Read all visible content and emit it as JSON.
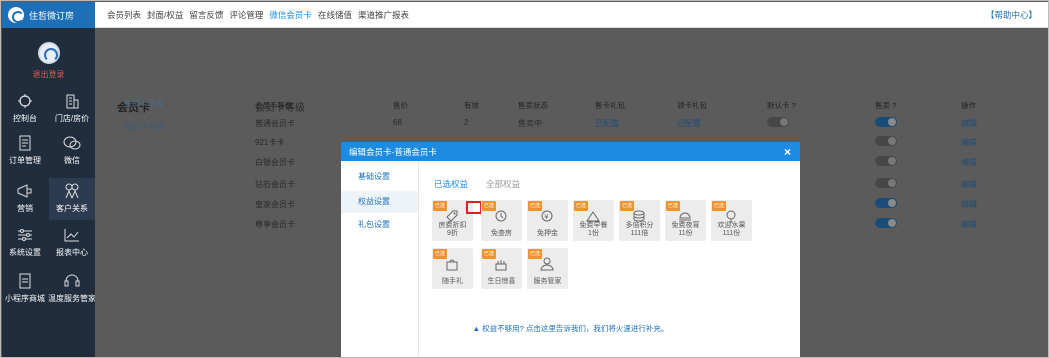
{
  "brand": {
    "name": "住哲微订房"
  },
  "sidebar": {
    "logout": "退出登录",
    "items": [
      {
        "label": "控制台",
        "icon": "dashboard-icon"
      },
      {
        "label": "门店/房价",
        "icon": "store-icon"
      },
      {
        "label": "订单管理",
        "icon": "order-icon"
      },
      {
        "label": "微信",
        "icon": "wechat-icon"
      },
      {
        "label": "营销",
        "icon": "marketing-icon"
      },
      {
        "label": "客户关系",
        "icon": "customer-icon"
      },
      {
        "label": "系统设置",
        "icon": "settings-icon"
      },
      {
        "label": "报表中心",
        "icon": "report-icon"
      },
      {
        "label": "小程序商城",
        "icon": "mall-icon"
      },
      {
        "label": "温度服务管家",
        "icon": "service-icon"
      }
    ]
  },
  "topnav": {
    "items": [
      "会员列表",
      "封面/权益",
      "留言反馈",
      "评论管理",
      "微信会员卡",
      "在线储值",
      "渠道推广报表"
    ],
    "active_index": 4,
    "help": "【帮助中心】"
  },
  "page": {
    "title": "会员卡",
    "left_tabs": [
      "会员卡设置",
      "会员卡升级"
    ],
    "level_title": "会员卡等级",
    "table": {
      "headers": [
        "会员卡等级",
        "售价",
        "有效",
        "售卖状态",
        "售卡礼包",
        "领卡礼包",
        "默认卡 ?",
        "售卖 ?",
        "操作"
      ],
      "rows": [
        {
          "name": "普通会员卡",
          "price": "68",
          "valid": "2",
          "status": "售卖中",
          "gift1": "已配置",
          "gift2": "已配置",
          "edit": "编辑"
        },
        {
          "name": "921卡卡",
          "price": "",
          "valid": "",
          "status": "",
          "gift1": "",
          "gift2": "",
          "edit": "编辑"
        },
        {
          "name": "白银会员卡",
          "price": "",
          "valid": "",
          "status": "",
          "gift1": "",
          "gift2": "",
          "edit": "编辑"
        },
        {
          "name": "钻石会员卡",
          "price": "",
          "valid": "",
          "status": "",
          "gift1": "",
          "gift2": "",
          "edit": "编辑"
        },
        {
          "name": "皇家会员卡",
          "price": "",
          "valid": "",
          "status": "",
          "gift1": "",
          "gift2": "",
          "edit": "编辑"
        },
        {
          "name": "尊享会员卡",
          "price": "",
          "valid": "",
          "status": "",
          "gift1": "",
          "gift2": "",
          "edit": "编辑"
        }
      ]
    }
  },
  "modal": {
    "title": "编辑会员卡-普通会员卡",
    "close": "×",
    "menu": [
      "基础设置",
      "权益设置",
      "礼包设置"
    ],
    "menu_selected": 1,
    "tabs": [
      "已选权益",
      "全部权益"
    ],
    "tag": "已选",
    "benefits": [
      {
        "label": "房费折扣",
        "sub": "9折",
        "icon": "discount-tag-icon"
      },
      {
        "label": "免查房",
        "sub": "",
        "icon": "no-inspection-icon"
      },
      {
        "label": "免押金",
        "sub": "",
        "icon": "no-deposit-icon"
      },
      {
        "label": "免费早餐",
        "sub": "1份",
        "icon": "breakfast-icon"
      },
      {
        "label": "多倍积分",
        "sub": "111倍",
        "icon": "points-icon"
      },
      {
        "label": "免费夜宵",
        "sub": "11份",
        "icon": "night-snack-icon"
      },
      {
        "label": "欢迎水果",
        "sub": "111份",
        "icon": "fruit-icon"
      },
      {
        "label": "随手礼",
        "sub": "",
        "icon": "gift-bag-icon"
      },
      {
        "label": "生日惊喜",
        "sub": "",
        "icon": "birthday-icon"
      },
      {
        "label": "服务管家",
        "sub": "",
        "icon": "butler-icon"
      }
    ],
    "footer": "▲ 权益不够用? 点击这里告诉我们，我们将火速进行补充。"
  },
  "colors": {
    "primary": "#1d8ce0",
    "brand": "#1d6fb8",
    "sidebar": "#1f2d3d",
    "tag": "#f0932b",
    "highlight": "#e02020"
  }
}
